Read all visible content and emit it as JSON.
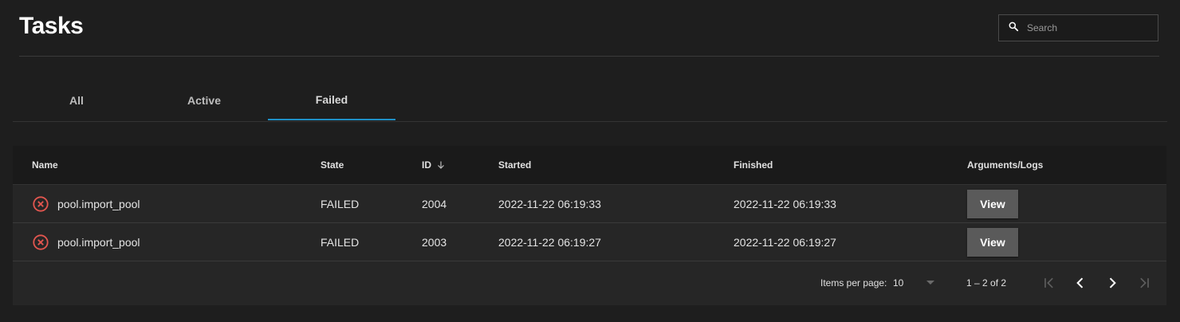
{
  "page": {
    "title": "Tasks"
  },
  "search": {
    "placeholder": "Search"
  },
  "tabs": [
    {
      "label": "All"
    },
    {
      "label": "Active"
    },
    {
      "label": "Failed"
    }
  ],
  "table": {
    "columns": {
      "name": "Name",
      "state": "State",
      "id": "ID",
      "started": "Started",
      "finished": "Finished",
      "args": "Arguments/Logs"
    },
    "rows": [
      {
        "name": "pool.import_pool",
        "state": "FAILED",
        "id": "2004",
        "started": "2022-11-22 06:19:33",
        "finished": "2022-11-22 06:19:33",
        "action": "View"
      },
      {
        "name": "pool.import_pool",
        "state": "FAILED",
        "id": "2003",
        "started": "2022-11-22 06:19:27",
        "finished": "2022-11-22 06:19:27",
        "action": "View"
      }
    ]
  },
  "paginator": {
    "items_per_page_label": "Items per page:",
    "page_size": "10",
    "range_label": "1 – 2 of 2"
  },
  "colors": {
    "accent": "#1f90c6",
    "error": "#e2564f",
    "background": "#1e1e1e",
    "card": "#262626"
  },
  "icons": [
    "search-icon",
    "error-circle-icon",
    "arrow-down-icon",
    "dropdown-arrow-icon",
    "first-page-icon",
    "previous-page-icon",
    "next-page-icon",
    "last-page-icon"
  ]
}
